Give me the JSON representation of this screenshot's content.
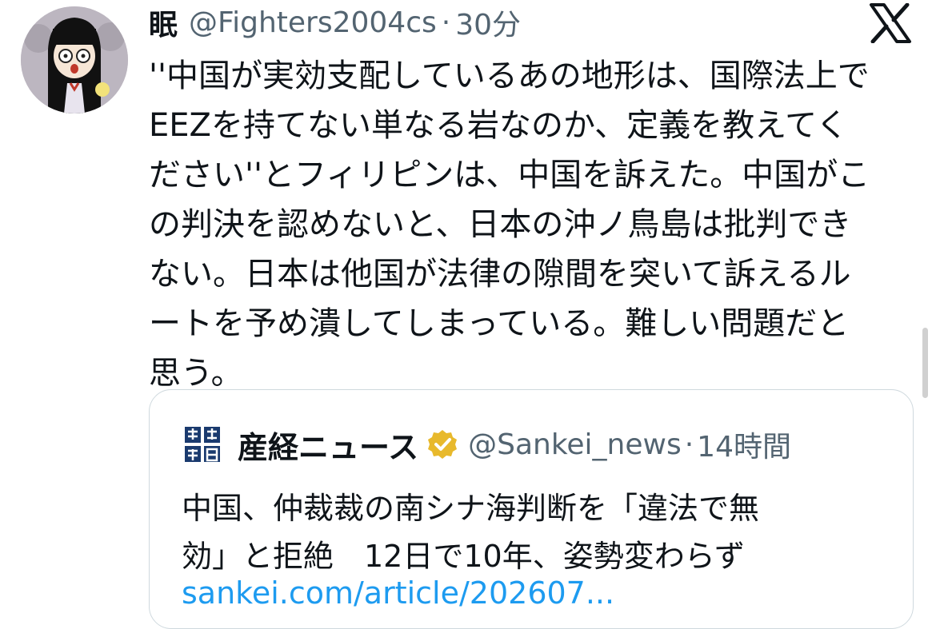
{
  "tweet": {
    "author_name": "眠",
    "author_handle": "@Fighters2004cs",
    "separator": "·",
    "time": "30分",
    "text": "''中国が実効支配しているあの地形は、国際法上で\nEEZを持てない単なる岩なのか、定義を教えてく\nださい''とフィリピンは、中国を訴えた。中国がこ\nの判決を認めないと、日本の沖ノ鳥島は批判でき\nない。日本は他国が法律の隙間を突いて訴えるル\nートを予め潰してしまっている。難しい問題だと\n思う。"
  },
  "quote": {
    "logo_text": "産經新聞",
    "author_name": "産経ニュース",
    "author_handle": "@Sankei_news",
    "separator": "·",
    "time": "14時間",
    "text": "中国、仲裁裁の南シナ海判断を「違法で無\n効」と拒絶　12日で10年、姿勢変わらず",
    "link": "sankei.com/article/202607..."
  },
  "icons": {
    "x_logo": "x-logo-icon",
    "verified": "verified-badge-icon"
  },
  "colors": {
    "text": "#0f1419",
    "secondary": "#536471",
    "link": "#1d9bf0",
    "verified_gold": "#e8b92c",
    "border": "#cfd9de"
  }
}
